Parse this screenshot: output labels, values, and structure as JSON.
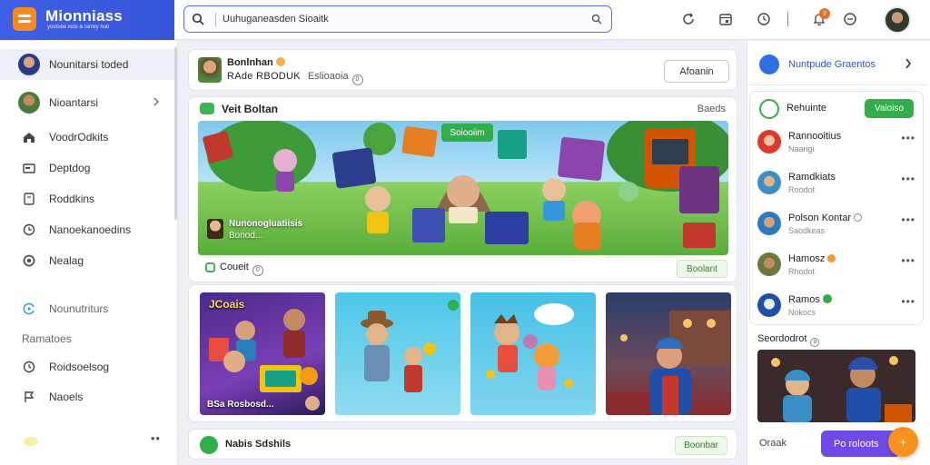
{
  "app": {
    "name": "Mionniass",
    "tagline": "youtube kids & family hub"
  },
  "search": {
    "value": "Uuhuganeasden Sioaitk",
    "placeholder": ""
  },
  "topbar": {
    "notification_count": "3"
  },
  "sidebar": {
    "items": [
      {
        "label": "Nounitarsi toded"
      },
      {
        "label": "Nioantarsi"
      },
      {
        "label": "VoodrOdkits"
      },
      {
        "label": "Deptdog"
      },
      {
        "label": "Roddkins"
      },
      {
        "label": "Nanoekanoedins"
      },
      {
        "label": "Nealag"
      }
    ],
    "section1": "Nounutriturs",
    "section2": "Ramatoes",
    "items2": [
      {
        "label": "Roidsoelsog"
      },
      {
        "label": "Naoels"
      }
    ]
  },
  "post_header": {
    "name": "Bonlnhan",
    "sub_main": "RAde RBODUK",
    "sub_light": "Eslioaoia",
    "follow_label": "Afoanin"
  },
  "featured": {
    "title": "Veit Boltan",
    "right_label": "Baeds",
    "banner_button": "Soiooiim",
    "caption1": "Nunonogluatiisis",
    "caption2": "Bonod...",
    "footer_label": "Coueit",
    "footer_button": "Boolant"
  },
  "tiles": [
    {
      "title": "JCoais",
      "caption": "BSa Rosbosd..."
    },
    {
      "title": "",
      "caption": ""
    },
    {
      "title": "",
      "caption": ""
    },
    {
      "title": "",
      "caption": ""
    }
  ],
  "bottom_card": {
    "label": "Nabis Sdshils",
    "button": "Boonbar"
  },
  "right": {
    "top_label": "Nuntpude Graentos",
    "list_title": "Rehuinte",
    "list_button": "Valoiso",
    "rows": [
      {
        "name": "Rannooitius",
        "sub": "Naarigi",
        "avatar_color": "#d93a2b"
      },
      {
        "name": "Ramdkiats",
        "sub": "Roodot",
        "avatar_color": "#3b8fc7"
      },
      {
        "name": "Polson Kontar",
        "sub": "Saodkeas",
        "avatar_color": "#2a7bc0"
      },
      {
        "name": "Hamosz",
        "sub": "Rhodot",
        "avatar_color": "#6a7a3a"
      },
      {
        "name": "Ramos",
        "sub": "Nokocs",
        "avatar_color": "#1f4fa8"
      }
    ],
    "section_label": "Seordodrot",
    "footer_label": "Oraak",
    "footer_button": "Po roloots"
  },
  "colors": {
    "accent": "#3f5fe6",
    "green": "#2fae4a",
    "orange": "#f7921e",
    "purple": "#6c4be8"
  }
}
